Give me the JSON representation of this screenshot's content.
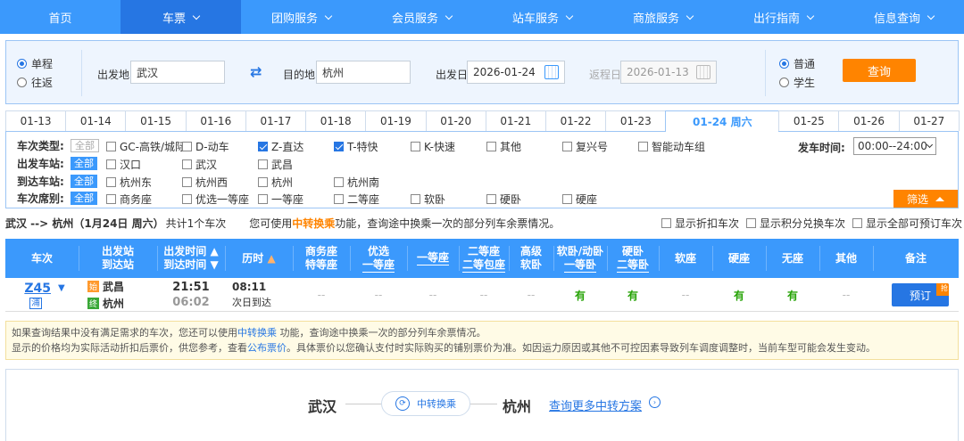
{
  "nav": [
    {
      "label": "首页",
      "dropdown": false,
      "active": false
    },
    {
      "label": "车票",
      "dropdown": true,
      "active": true
    },
    {
      "label": "团购服务",
      "dropdown": true,
      "active": false
    },
    {
      "label": "会员服务",
      "dropdown": true,
      "active": false
    },
    {
      "label": "站车服务",
      "dropdown": true,
      "active": false
    },
    {
      "label": "商旅服务",
      "dropdown": true,
      "active": false
    },
    {
      "label": "出行指南",
      "dropdown": true,
      "active": false
    },
    {
      "label": "信息查询",
      "dropdown": true,
      "active": false
    }
  ],
  "search": {
    "trip_type": {
      "one_way": "单程",
      "round_trip": "往返",
      "selected": "one_way"
    },
    "from_label": "出发地",
    "from_value": "武汉",
    "to_label": "目的地",
    "to_value": "杭州",
    "depart_label": "出发日",
    "depart_value": "2026-01-24",
    "return_label": "返程日",
    "return_value": "2026-01-13",
    "passenger": {
      "normal": "普通",
      "student": "学生",
      "selected": "normal"
    },
    "query_label": "查询"
  },
  "date_tabs": [
    "01-13",
    "01-14",
    "01-15",
    "01-16",
    "01-17",
    "01-18",
    "01-19",
    "01-20",
    "01-21",
    "01-22",
    "01-23",
    "01-24 周六",
    "01-25",
    "01-26",
    "01-27"
  ],
  "active_date_index": 11,
  "filters": {
    "type_label": "车次类型:",
    "type_all": "全部",
    "types": [
      {
        "label": "GC-高铁/城际",
        "checked": false
      },
      {
        "label": "D-动车",
        "checked": false
      },
      {
        "label": "Z-直达",
        "checked": true
      },
      {
        "label": "T-特快",
        "checked": true
      },
      {
        "label": "K-快速",
        "checked": false
      },
      {
        "label": "其他",
        "checked": false
      },
      {
        "label": "复兴号",
        "checked": false
      },
      {
        "label": "智能动车组",
        "checked": false
      }
    ],
    "depart_time_label": "发车时间:",
    "depart_time_value": "00:00--24:00",
    "from_station_label": "出发车站:",
    "from_all": "全部",
    "from_stations": [
      "汉口",
      "武汉",
      "武昌"
    ],
    "to_station_label": "到达车站:",
    "to_all": "全部",
    "to_stations": [
      "杭州东",
      "杭州西",
      "杭州",
      "杭州南"
    ],
    "seat_label": "车次席别:",
    "seat_all": "全部",
    "seats": [
      "商务座",
      "优选一等座",
      "一等座",
      "二等座",
      "软卧",
      "硬卧",
      "硬座"
    ],
    "filter_btn": "筛选"
  },
  "summary": {
    "route": "武汉 --> 杭州（1月24日  周六）",
    "count_text": "共计1个车次",
    "tip_pre": "您可使用",
    "tip_link": "中转换乘",
    "tip_post": "功能，查询途中换乘一次的部分列车余票情况。",
    "opt1": "显示折扣车次",
    "opt2": "显示积分兑换车次",
    "opt3": "显示全部可预订车次"
  },
  "table": {
    "headers": {
      "train": "车次",
      "station_a": "出发站",
      "station_b": "到达站",
      "time_a": "出发时间",
      "time_b": "到达时间",
      "duration": "历时",
      "business_a": "商务座",
      "business_b": "特等座",
      "premium_a": "优选",
      "premium_b": "一等座",
      "first": "一等座",
      "second_a": "二等座",
      "second_b": "二等包座",
      "high_a": "高级",
      "high_b": "软卧",
      "soft_a": "软卧/动卧",
      "soft_b": "一等卧",
      "hard_a": "硬卧",
      "hard_b": "二等卧",
      "softseat": "软座",
      "hardseat": "硬座",
      "noseat": "无座",
      "other": "其他",
      "remark": "备注"
    },
    "row": {
      "train": "Z45",
      "tag": "浦",
      "from_badge": "始",
      "from": "武昌",
      "to_badge": "终",
      "to": "杭州",
      "depart": "21:51",
      "arrive": "06:02",
      "duration": "08:11",
      "arrive_day": "次日到达",
      "seats": [
        "--",
        "--",
        "--",
        "--",
        "--",
        "有",
        "有",
        "--",
        "有",
        "有",
        "--"
      ],
      "book": "预订",
      "corner": "抢"
    }
  },
  "notice": {
    "line1_pre": "如果查询结果中没有满足需求的车次，您还可以使用",
    "line1_link": "中转换乘",
    "line1_post": " 功能，查询途中换乘一次的部分列车余票情况。",
    "line2_pre": "显示的价格均为实际活动折扣后票价，供您参考，查看",
    "line2_link": "公布票价",
    "line2_post": "。具体票价以您确认支付时实际购买的铺别票价为准。如因运力原因或其他不可控因素导致列车调度调整时，当前车型可能会发生变动。"
  },
  "transfer": {
    "from": "武汉",
    "pill": "中转换乘",
    "to": "杭州",
    "more": "查询更多中转方案"
  },
  "colors": {
    "nav": "#3b99fc",
    "accent": "#2676e3",
    "orange": "#ff8400",
    "available": "#26a306"
  }
}
